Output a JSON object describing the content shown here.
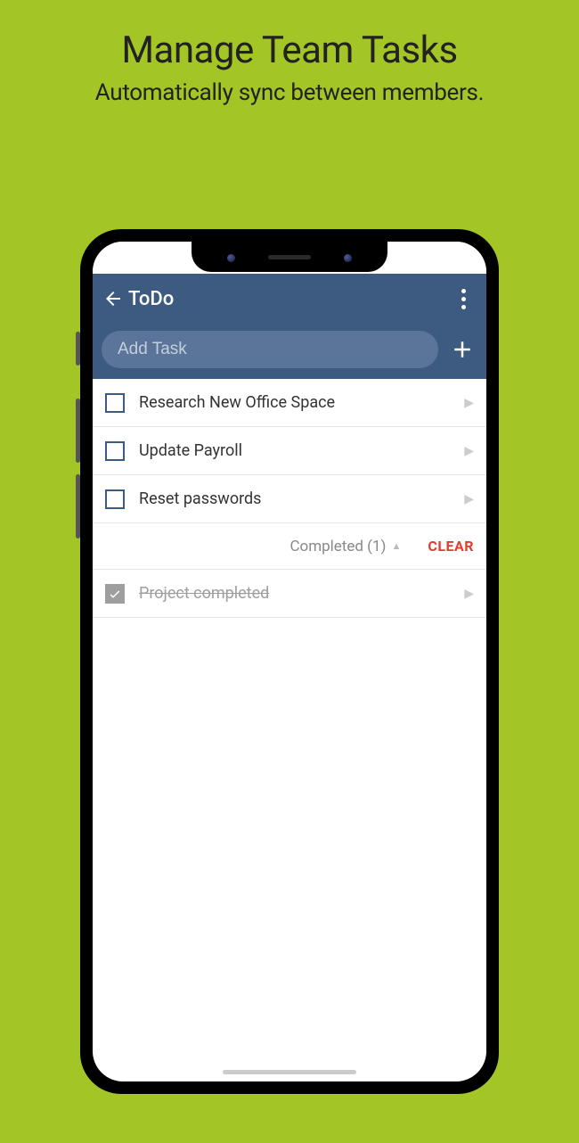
{
  "promo": {
    "title": "Manage Team Tasks",
    "subtitle": "Automatically sync between members."
  },
  "appbar": {
    "title": "ToDo"
  },
  "input": {
    "placeholder": "Add Task"
  },
  "tasks": [
    {
      "label": "Research New Office Space",
      "done": false
    },
    {
      "label": "Update Payroll",
      "done": false
    },
    {
      "label": "Reset passwords",
      "done": false
    }
  ],
  "completed_section": {
    "label": "Completed (1)",
    "clear_label": "CLEAR"
  },
  "completed_tasks": [
    {
      "label": "Project completed",
      "done": true
    }
  ],
  "colors": {
    "background": "#a3c626",
    "header": "#3d5a80",
    "clear": "#e03c31"
  }
}
